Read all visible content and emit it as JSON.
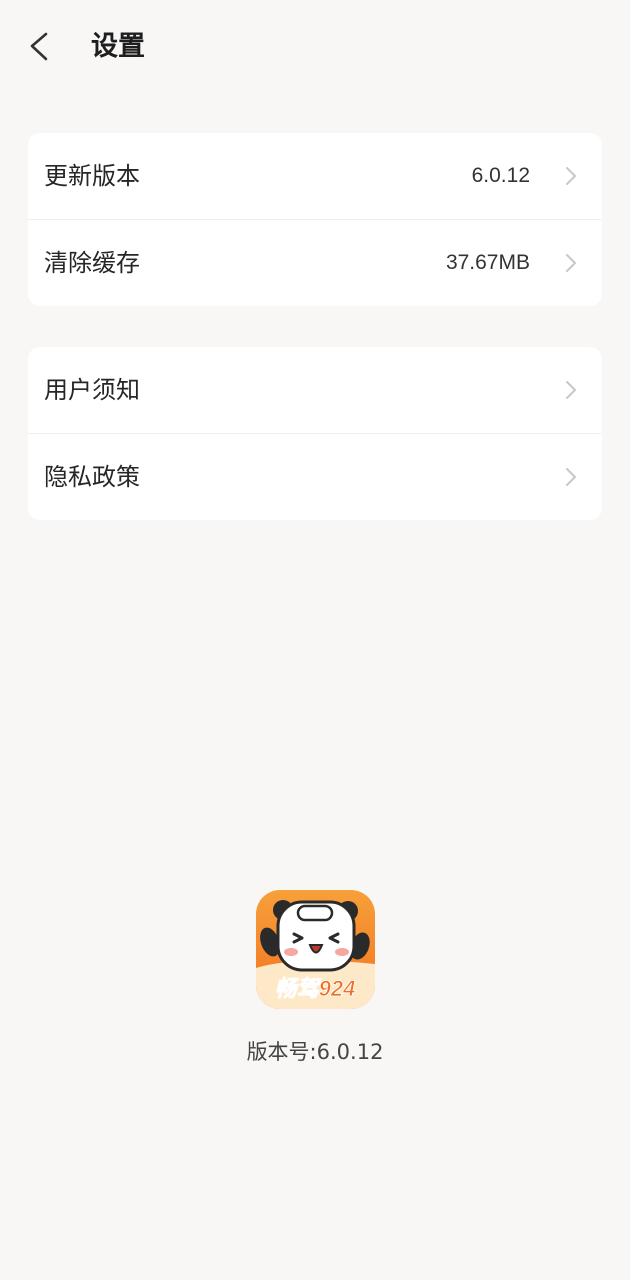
{
  "header": {
    "title": "设置",
    "back_icon": "chevron-left-icon"
  },
  "group1": {
    "items": [
      {
        "label": "更新版本",
        "value": "6.0.12"
      },
      {
        "label": "清除缓存",
        "value": "37.67MB"
      }
    ]
  },
  "group2": {
    "items": [
      {
        "label": "用户须知"
      },
      {
        "label": "隐私政策"
      }
    ]
  },
  "footer": {
    "logo_text": "畅驾924",
    "version": "版本号:6.0.12"
  },
  "colors": {
    "background": "#f8f7f5",
    "card": "#ffffff",
    "logo_orange": "#f58a2c",
    "chevron": "#c8c8c8"
  }
}
